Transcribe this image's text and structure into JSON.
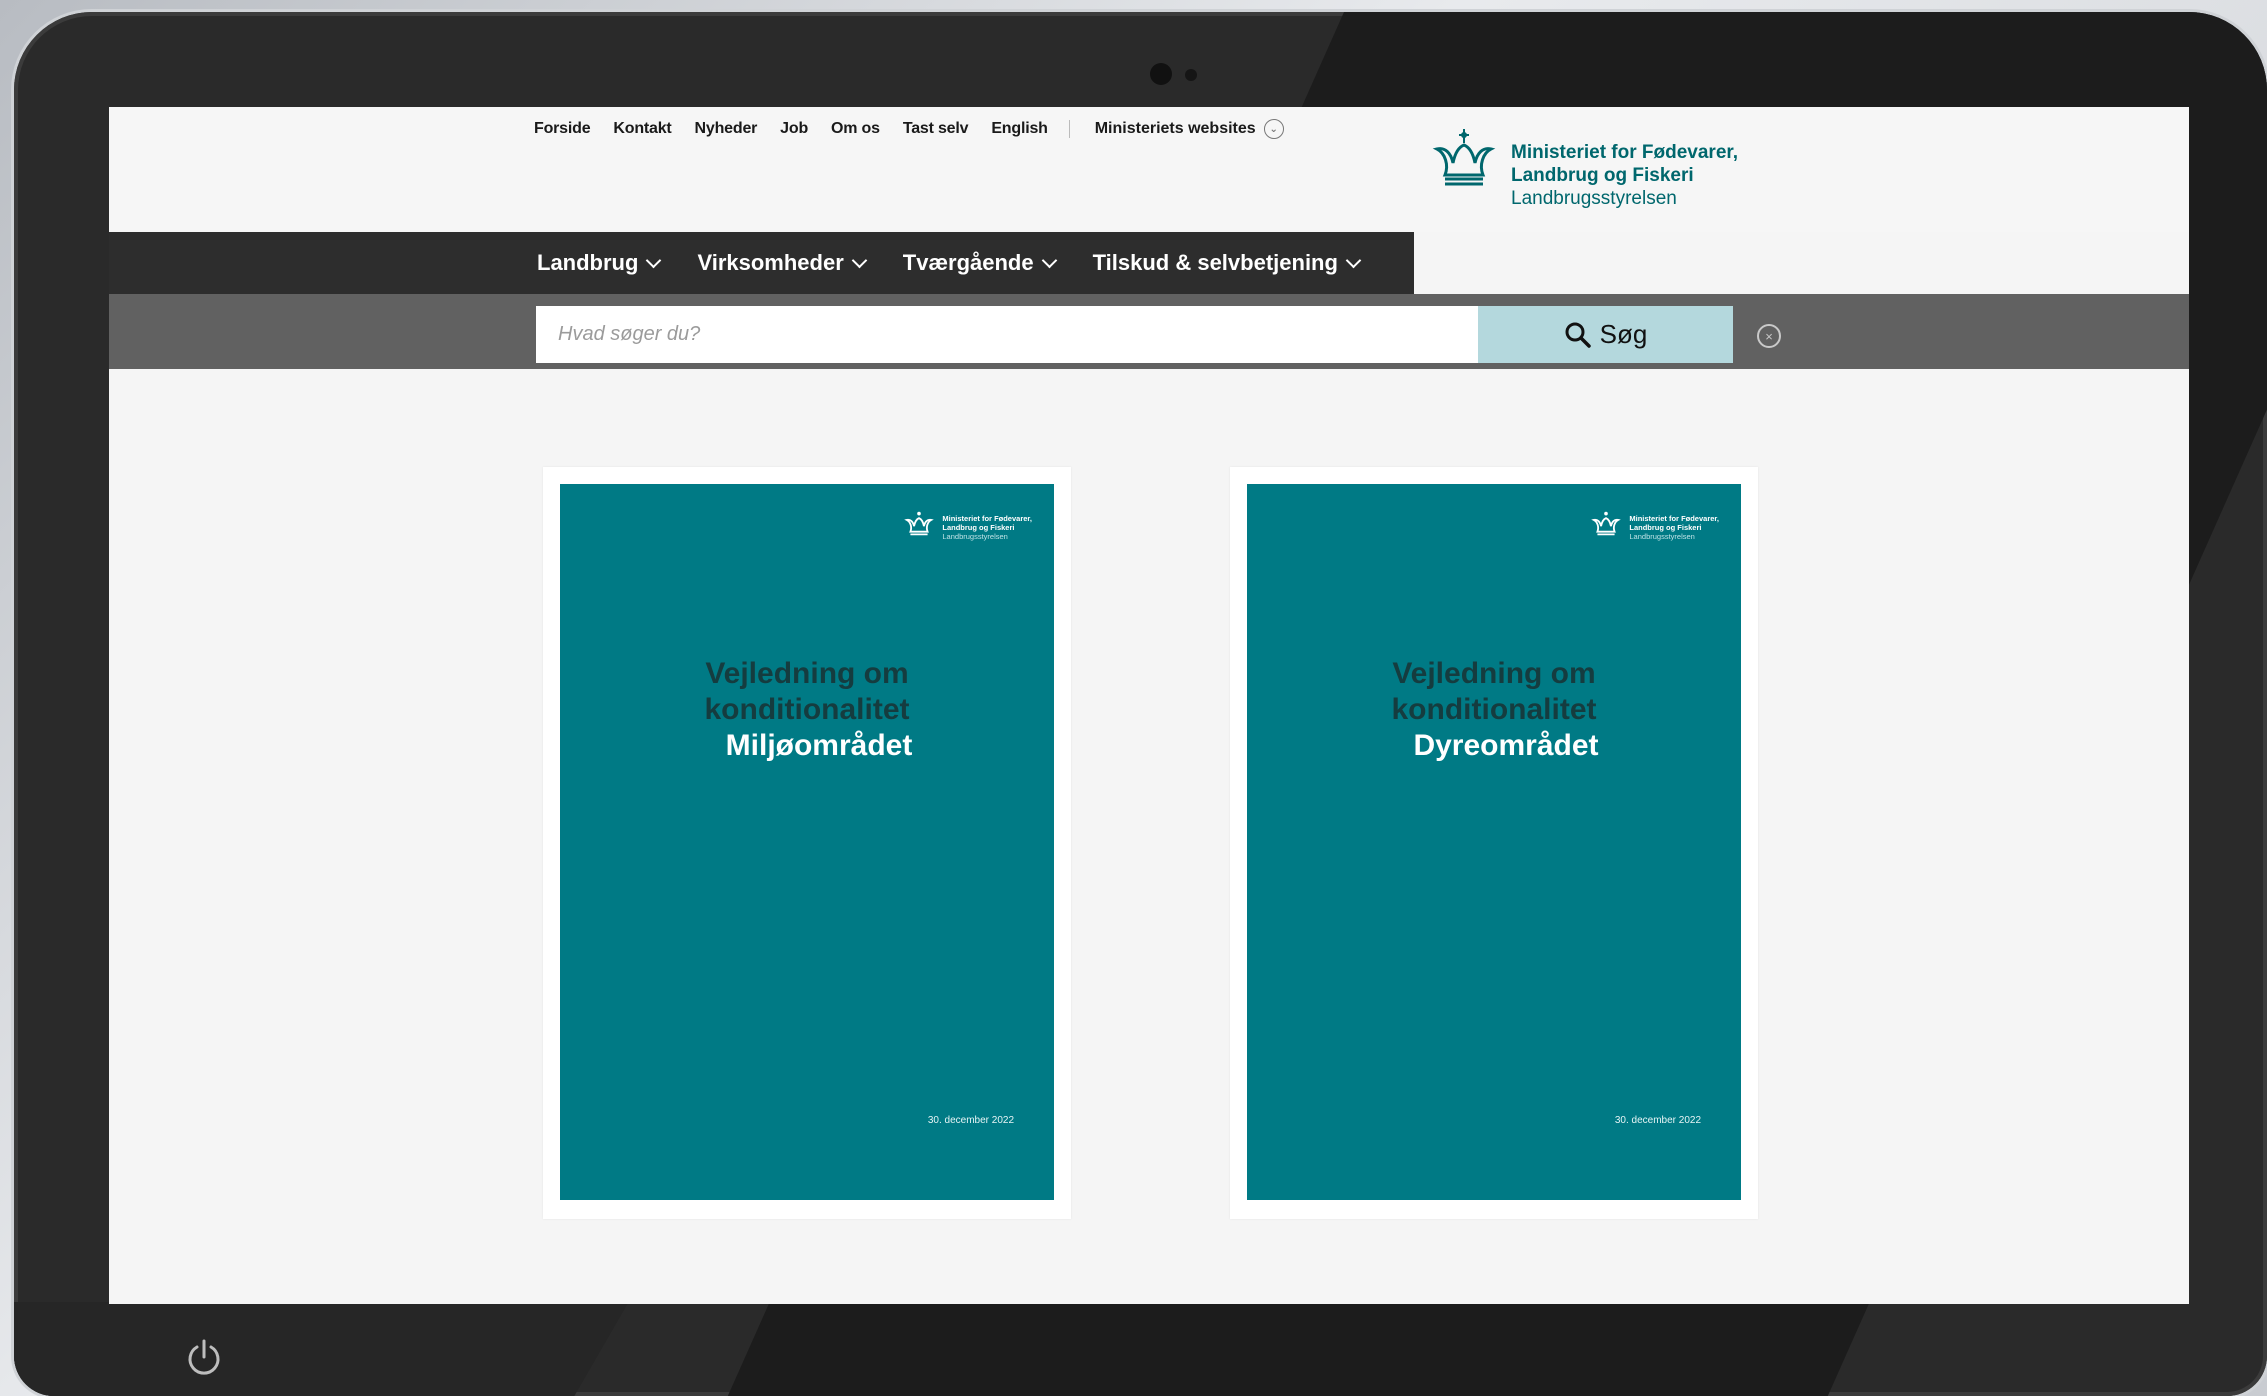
{
  "top_links": [
    "Forside",
    "Kontakt",
    "Nyheder",
    "Job",
    "Om os",
    "Tast selv",
    "English"
  ],
  "ministry_websites": "Ministeriets websites",
  "logo": {
    "line1": "Ministeriet for Fødevarer,",
    "line2": "Landbrug og Fiskeri",
    "line3": "Landbrugsstyrelsen"
  },
  "nav": [
    "Landbrug",
    "Virksomheder",
    "Tværgående",
    "Tilskud & selvbetjening"
  ],
  "search": {
    "placeholder": "Hvad søger du?",
    "button": "Søg"
  },
  "publications": [
    {
      "logo_line1": "Ministeriet for Fødevarer,",
      "logo_line2": "Landbrug og Fiskeri",
      "logo_line3": "Landbrugsstyrelsen",
      "title_line1": "Vejledning om",
      "title_line2": "konditionalitet",
      "subtitle": "Miljøområdet",
      "date": "30. december 2022"
    },
    {
      "logo_line1": "Ministeriet for Fødevarer,",
      "logo_line2": "Landbrug og Fiskeri",
      "logo_line3": "Landbrugsstyrelsen",
      "title_line1": "Vejledning om",
      "title_line2": "konditionalitet",
      "subtitle": "Dyreområdet",
      "date": "30. december 2022"
    }
  ],
  "colors": {
    "brand_teal": "#00676d",
    "cover_teal": "#007a85",
    "nav_dark": "#2d2d2d",
    "search_button": "#b4d8dd"
  }
}
